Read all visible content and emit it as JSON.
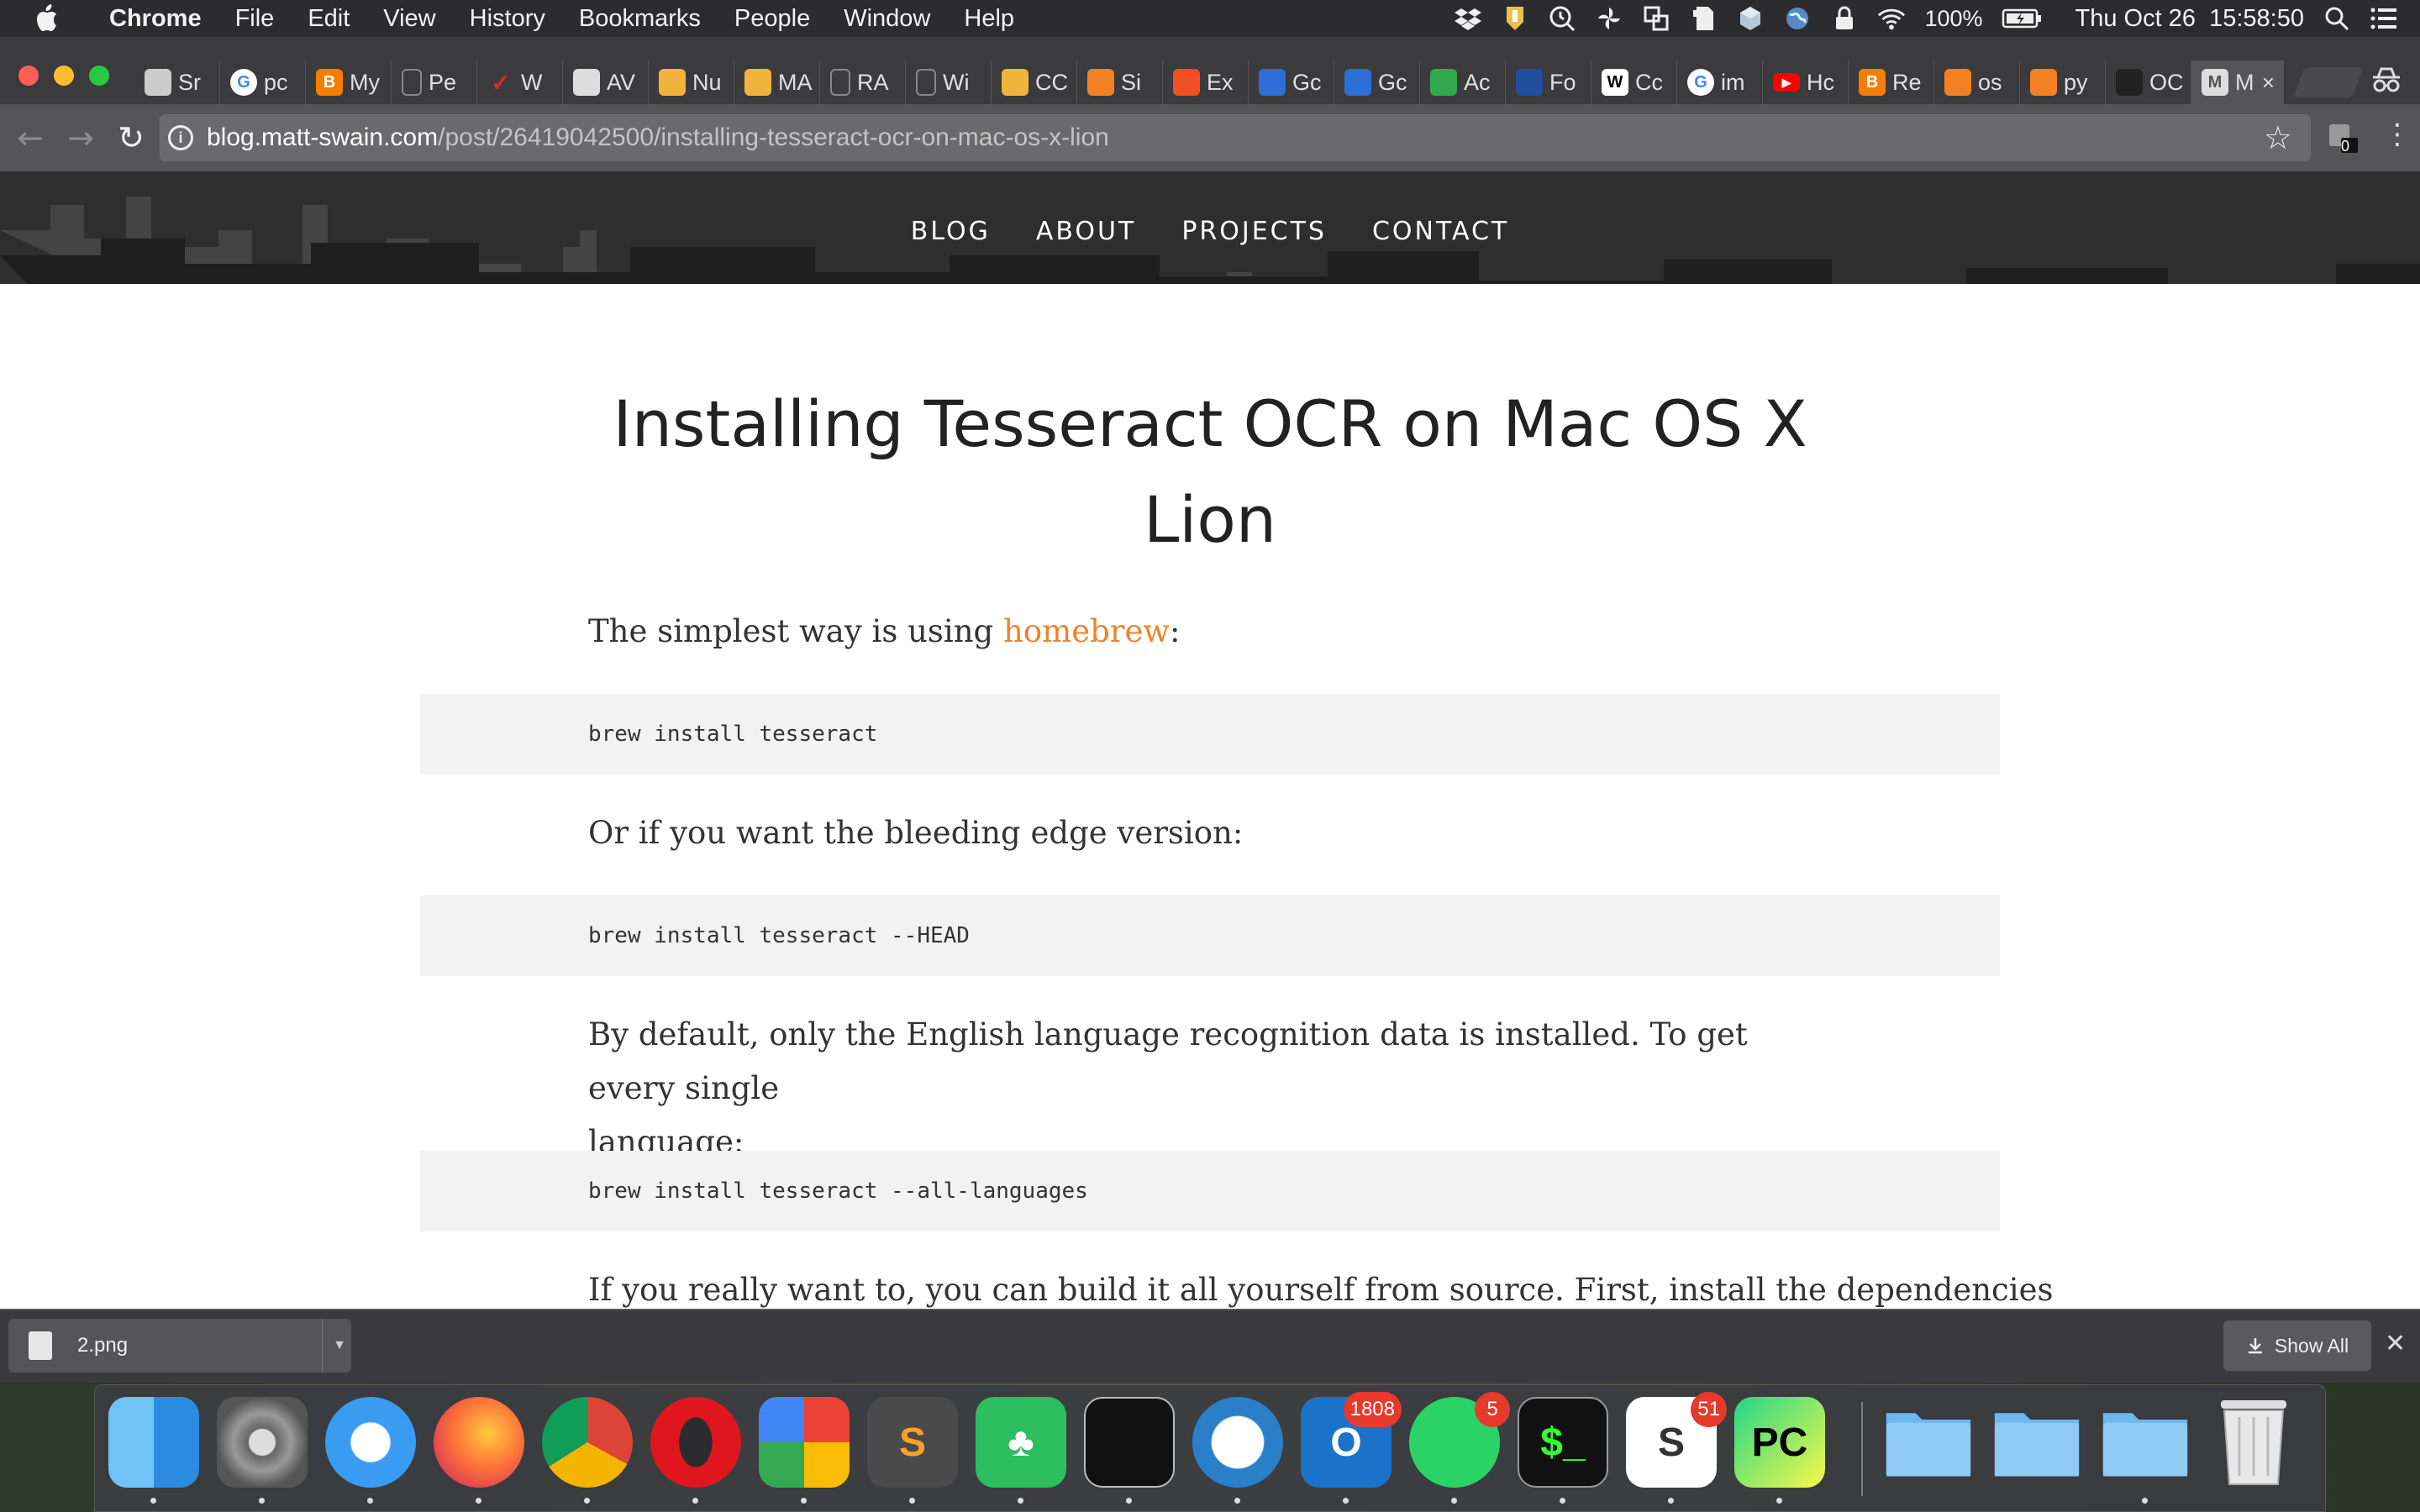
{
  "menubar": {
    "app": "Chrome",
    "items": [
      "File",
      "Edit",
      "View",
      "History",
      "Bookmarks",
      "People",
      "Window",
      "Help"
    ],
    "battery": "100%",
    "clock": "Thu Oct 26  15:58:50"
  },
  "tabs": [
    {
      "label": "Sr",
      "icon": "building-icon",
      "color": "#cccccc"
    },
    {
      "label": "pc",
      "icon": "google-icon",
      "color": "#ffffff"
    },
    {
      "label": "My",
      "icon": "blogger-icon",
      "color": "#f57d00"
    },
    {
      "label": "Pe",
      "icon": "page-icon",
      "color": "#888888"
    },
    {
      "label": "W",
      "icon": "checkmark-icon",
      "color": "#d42a2a"
    },
    {
      "label": "AV",
      "icon": "diamond-icon",
      "color": "#dddddd"
    },
    {
      "label": "Nu",
      "icon": "box-icon",
      "color": "#f2b33d"
    },
    {
      "label": "MA",
      "icon": "box-icon",
      "color": "#f2b33d"
    },
    {
      "label": "RA",
      "icon": "page-icon",
      "color": "#888888"
    },
    {
      "label": "Wi",
      "icon": "page-icon",
      "color": "#888888"
    },
    {
      "label": "CC",
      "icon": "box-icon",
      "color": "#f2b33d"
    },
    {
      "label": "Si",
      "icon": "stackoverflow-icon",
      "color": "#f48024"
    },
    {
      "label": "Ex",
      "icon": "microsoft-icon",
      "color": "#f25022"
    },
    {
      "label": "Gc",
      "icon": "house-icon",
      "color": "#2d6fd6"
    },
    {
      "label": "Gc",
      "icon": "house-icon",
      "color": "#2d6fd6"
    },
    {
      "label": "Ac",
      "icon": "phone-icon",
      "color": "#2fa84f"
    },
    {
      "label": "Fo",
      "icon": "shield-icon",
      "color": "#1f4f9c"
    },
    {
      "label": "Cc",
      "icon": "wikipedia-icon",
      "color": "#ffffff"
    },
    {
      "label": "im",
      "icon": "google-icon",
      "color": "#ffffff"
    },
    {
      "label": "Hc",
      "icon": "youtube-icon",
      "color": "#ff0000"
    },
    {
      "label": "Re",
      "icon": "blogger-icon",
      "color": "#f57d00"
    },
    {
      "label": "os",
      "icon": "stackoverflow-icon",
      "color": "#f48024"
    },
    {
      "label": "py",
      "icon": "stackoverflow-icon",
      "color": "#f48024"
    },
    {
      "label": "OC",
      "icon": "github-icon",
      "color": "#222222"
    },
    {
      "label": "M",
      "icon": "page-m-icon",
      "color": "#dddddd",
      "active": true
    }
  ],
  "address": {
    "host": "blog.matt-swain.com",
    "path": "/post/26419042500/installing-tesseract-ocr-on-mac-os-x-lion",
    "extension_badge": "0"
  },
  "site_nav": [
    "BLOG",
    "ABOUT",
    "PROJECTS",
    "CONTACT"
  ],
  "article": {
    "title_line1": "Installing Tesseract OCR on Mac OS X",
    "title_line2": "Lion",
    "p1_before": "The simplest way is using ",
    "p1_link": "homebrew",
    "p1_after": ":",
    "code1": "brew install tesseract",
    "p2": "Or if you want the bleeding edge version:",
    "code2": "brew install tesseract --HEAD",
    "p3_line1": "By default, only the English language recognition data is installed. To get every single",
    "p3_line2": "language:",
    "code3": "brew install tesseract --all-languages",
    "p4": "If you really want to, you can build it all yourself from source. First, install the dependencies"
  },
  "download_shelf": {
    "file": "2.png",
    "show_all": "Show All"
  },
  "dock": {
    "apps": [
      {
        "name": "Finder",
        "icon": "finder-icon",
        "badge": ""
      },
      {
        "name": "System Preferences",
        "icon": "gear-icon",
        "badge": ""
      },
      {
        "name": "Safari",
        "icon": "compass-icon",
        "badge": ""
      },
      {
        "name": "Firefox",
        "icon": "firefox-icon",
        "badge": ""
      },
      {
        "name": "Chrome",
        "icon": "chrome-icon",
        "badge": ""
      },
      {
        "name": "Opera",
        "icon": "opera-icon",
        "badge": ""
      },
      {
        "name": "Chrome App Launcher",
        "icon": "app-launcher-icon",
        "badge": ""
      },
      {
        "name": "Sublime Text",
        "icon": "sublime-icon",
        "badge": ""
      },
      {
        "name": "Evernote",
        "icon": "evernote-icon",
        "badge": ""
      },
      {
        "name": "Quest Software",
        "icon": "quest-icon",
        "badge": ""
      },
      {
        "name": "Network Connect",
        "icon": "network-icon",
        "badge": ""
      },
      {
        "name": "Outlook",
        "icon": "outlook-icon",
        "badge": "1808"
      },
      {
        "name": "WhatsApp",
        "icon": "whatsapp-icon",
        "badge": "5"
      },
      {
        "name": "Terminal",
        "icon": "terminal-icon",
        "badge": ""
      },
      {
        "name": "Slack",
        "icon": "slack-icon",
        "badge": "51"
      },
      {
        "name": "PyCharm",
        "icon": "pycharm-icon",
        "badge": ""
      }
    ],
    "folders": [
      {
        "name": "Applications",
        "icon": "applications-folder-icon"
      },
      {
        "name": "Documents",
        "icon": "documents-folder-icon"
      },
      {
        "name": "Downloads",
        "icon": "downloads-folder-icon"
      },
      {
        "name": "Trash",
        "icon": "trash-icon"
      }
    ]
  }
}
